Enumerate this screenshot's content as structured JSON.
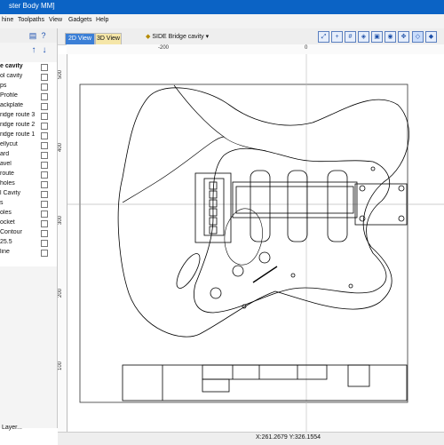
{
  "window": {
    "title": "ster Body MM]"
  },
  "menu": [
    "hine",
    "Toolpaths",
    "View",
    "Gadgets",
    "Help"
  ],
  "tabs": {
    "view2d": "2D View",
    "view3d": "3D View"
  },
  "view_selector": "SIDE Bridge cavity",
  "layers": [
    "e cavity",
    "ol cavity",
    "ps",
    "Profile",
    "ackplate",
    "ridge route 3",
    "ridge route 2",
    "ridge route 1",
    "ellycut",
    "ard",
    "avel",
    " route",
    " holes",
    "l Cavity",
    "s",
    "oles",
    "ocket",
    "Contour",
    "25.5",
    "line"
  ],
  "layer_panel_footer": "Layer...",
  "rulers": {
    "top": [
      "-200",
      "0"
    ],
    "left": [
      "500",
      "400",
      "300",
      "200",
      "100"
    ]
  },
  "status": {
    "coords": "X:261.2679 Y:326.1554"
  },
  "icons": {
    "panel_tools": [
      "sheet-icon",
      "help-icon",
      "up-arrow-icon",
      "down-arrow-icon"
    ],
    "view_tools": [
      "zoom-fit-icon",
      "zoom-in-icon",
      "grid-icon",
      "snap-icon",
      "zoom-box-icon",
      "zoom-previous-icon",
      "pan-icon",
      "wireframe-icon",
      "shaded-icon",
      "axes-icon"
    ]
  }
}
